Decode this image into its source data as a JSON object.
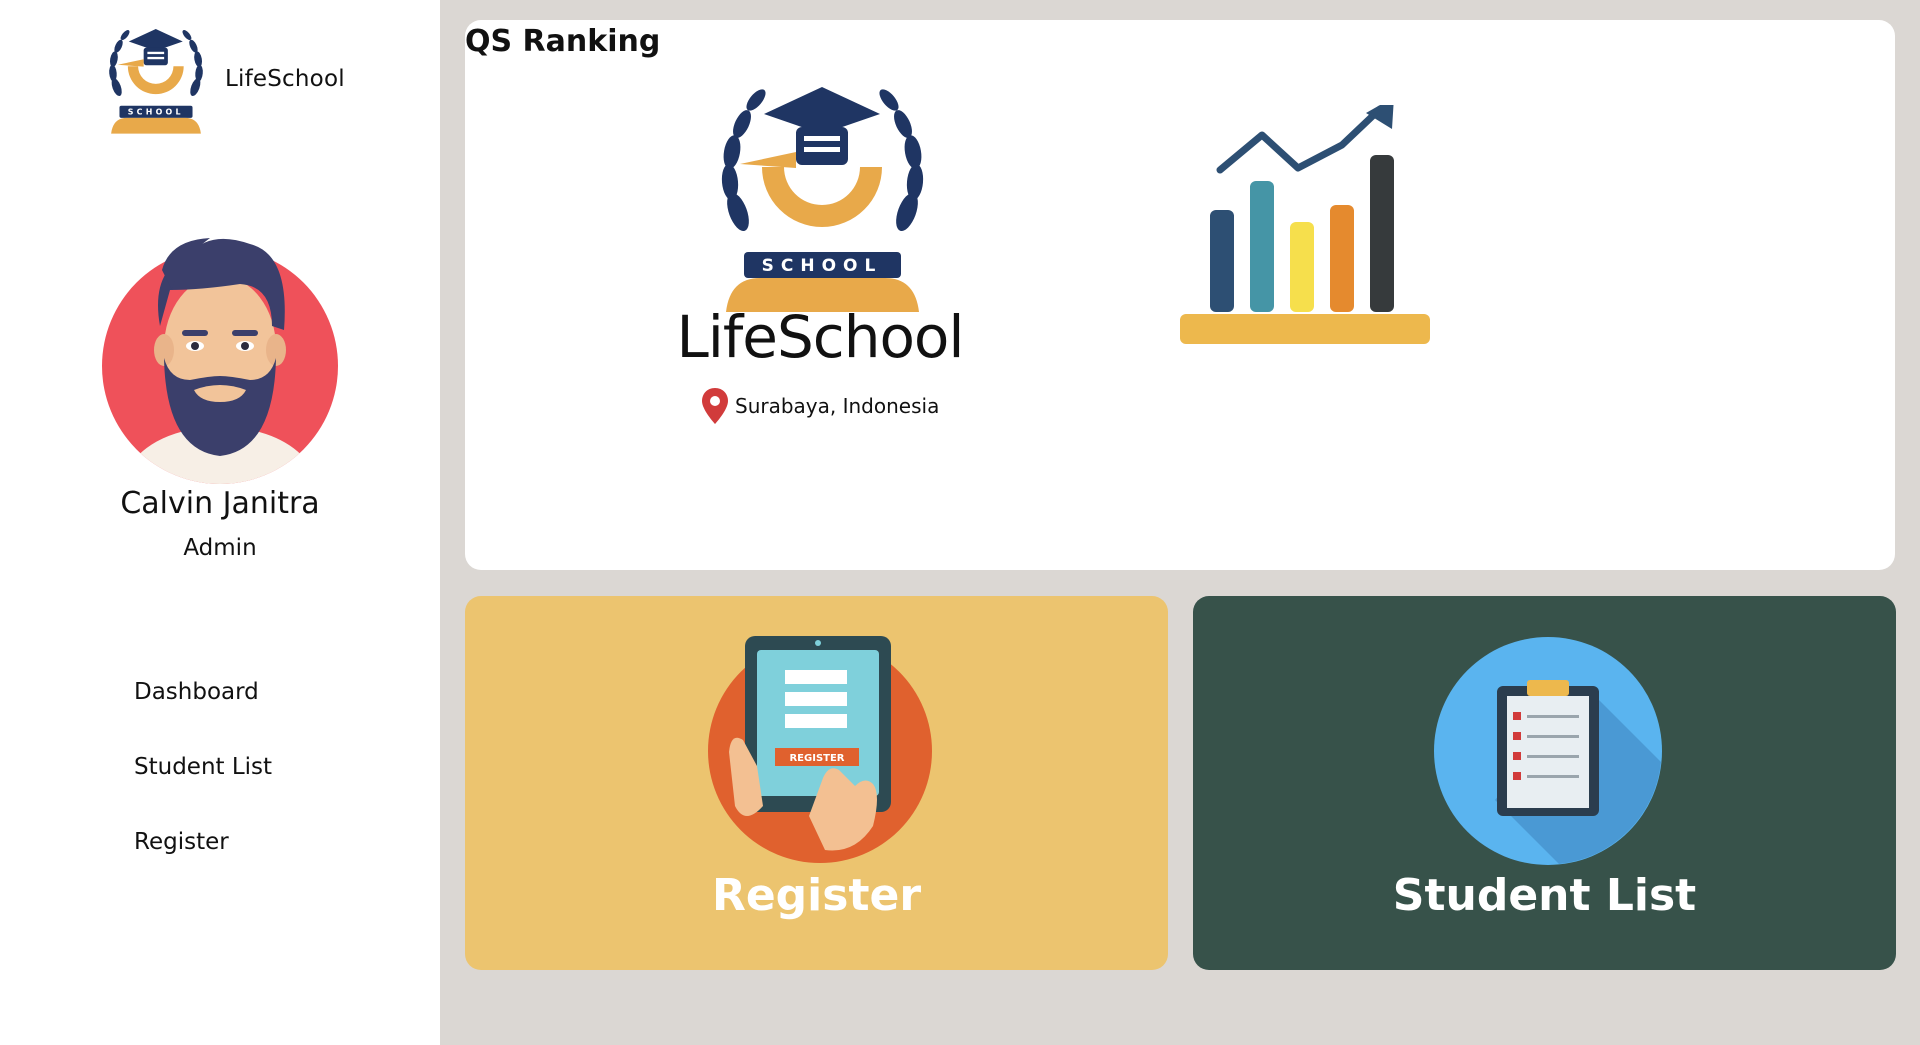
{
  "sidebar": {
    "brand": {
      "name": "LifeSchool",
      "logo_icon": "school-emblem-icon",
      "logo_text": "SCHOOL"
    },
    "user": {
      "avatar_icon": "bearded-man-avatar",
      "name": "Calvin Janitra",
      "role": "Admin"
    },
    "nav": [
      {
        "label": "Dashboard"
      },
      {
        "label": "Student List"
      },
      {
        "label": "Register"
      }
    ]
  },
  "ranking": {
    "title": "QS Ranking",
    "school_name": "LifeSchool",
    "emblem_text": "SCHOOL",
    "location": "Surabaya, Indonesia",
    "location_icon": "map-pin-icon",
    "chart_icon": "growth-bar-chart-icon"
  },
  "tiles": {
    "register": {
      "label": "Register",
      "icon": "tablet-register-icon",
      "icon_text": "REGISTER"
    },
    "student_list": {
      "label": "Student List",
      "icon": "clipboard-checklist-icon"
    }
  },
  "colors": {
    "background": "#dbd7d3",
    "register_tile": "#ecc46f",
    "student_tile": "#37524a",
    "navy": "#1f3563",
    "gold": "#e8a94a",
    "avatar_bg": "#ef515a"
  }
}
